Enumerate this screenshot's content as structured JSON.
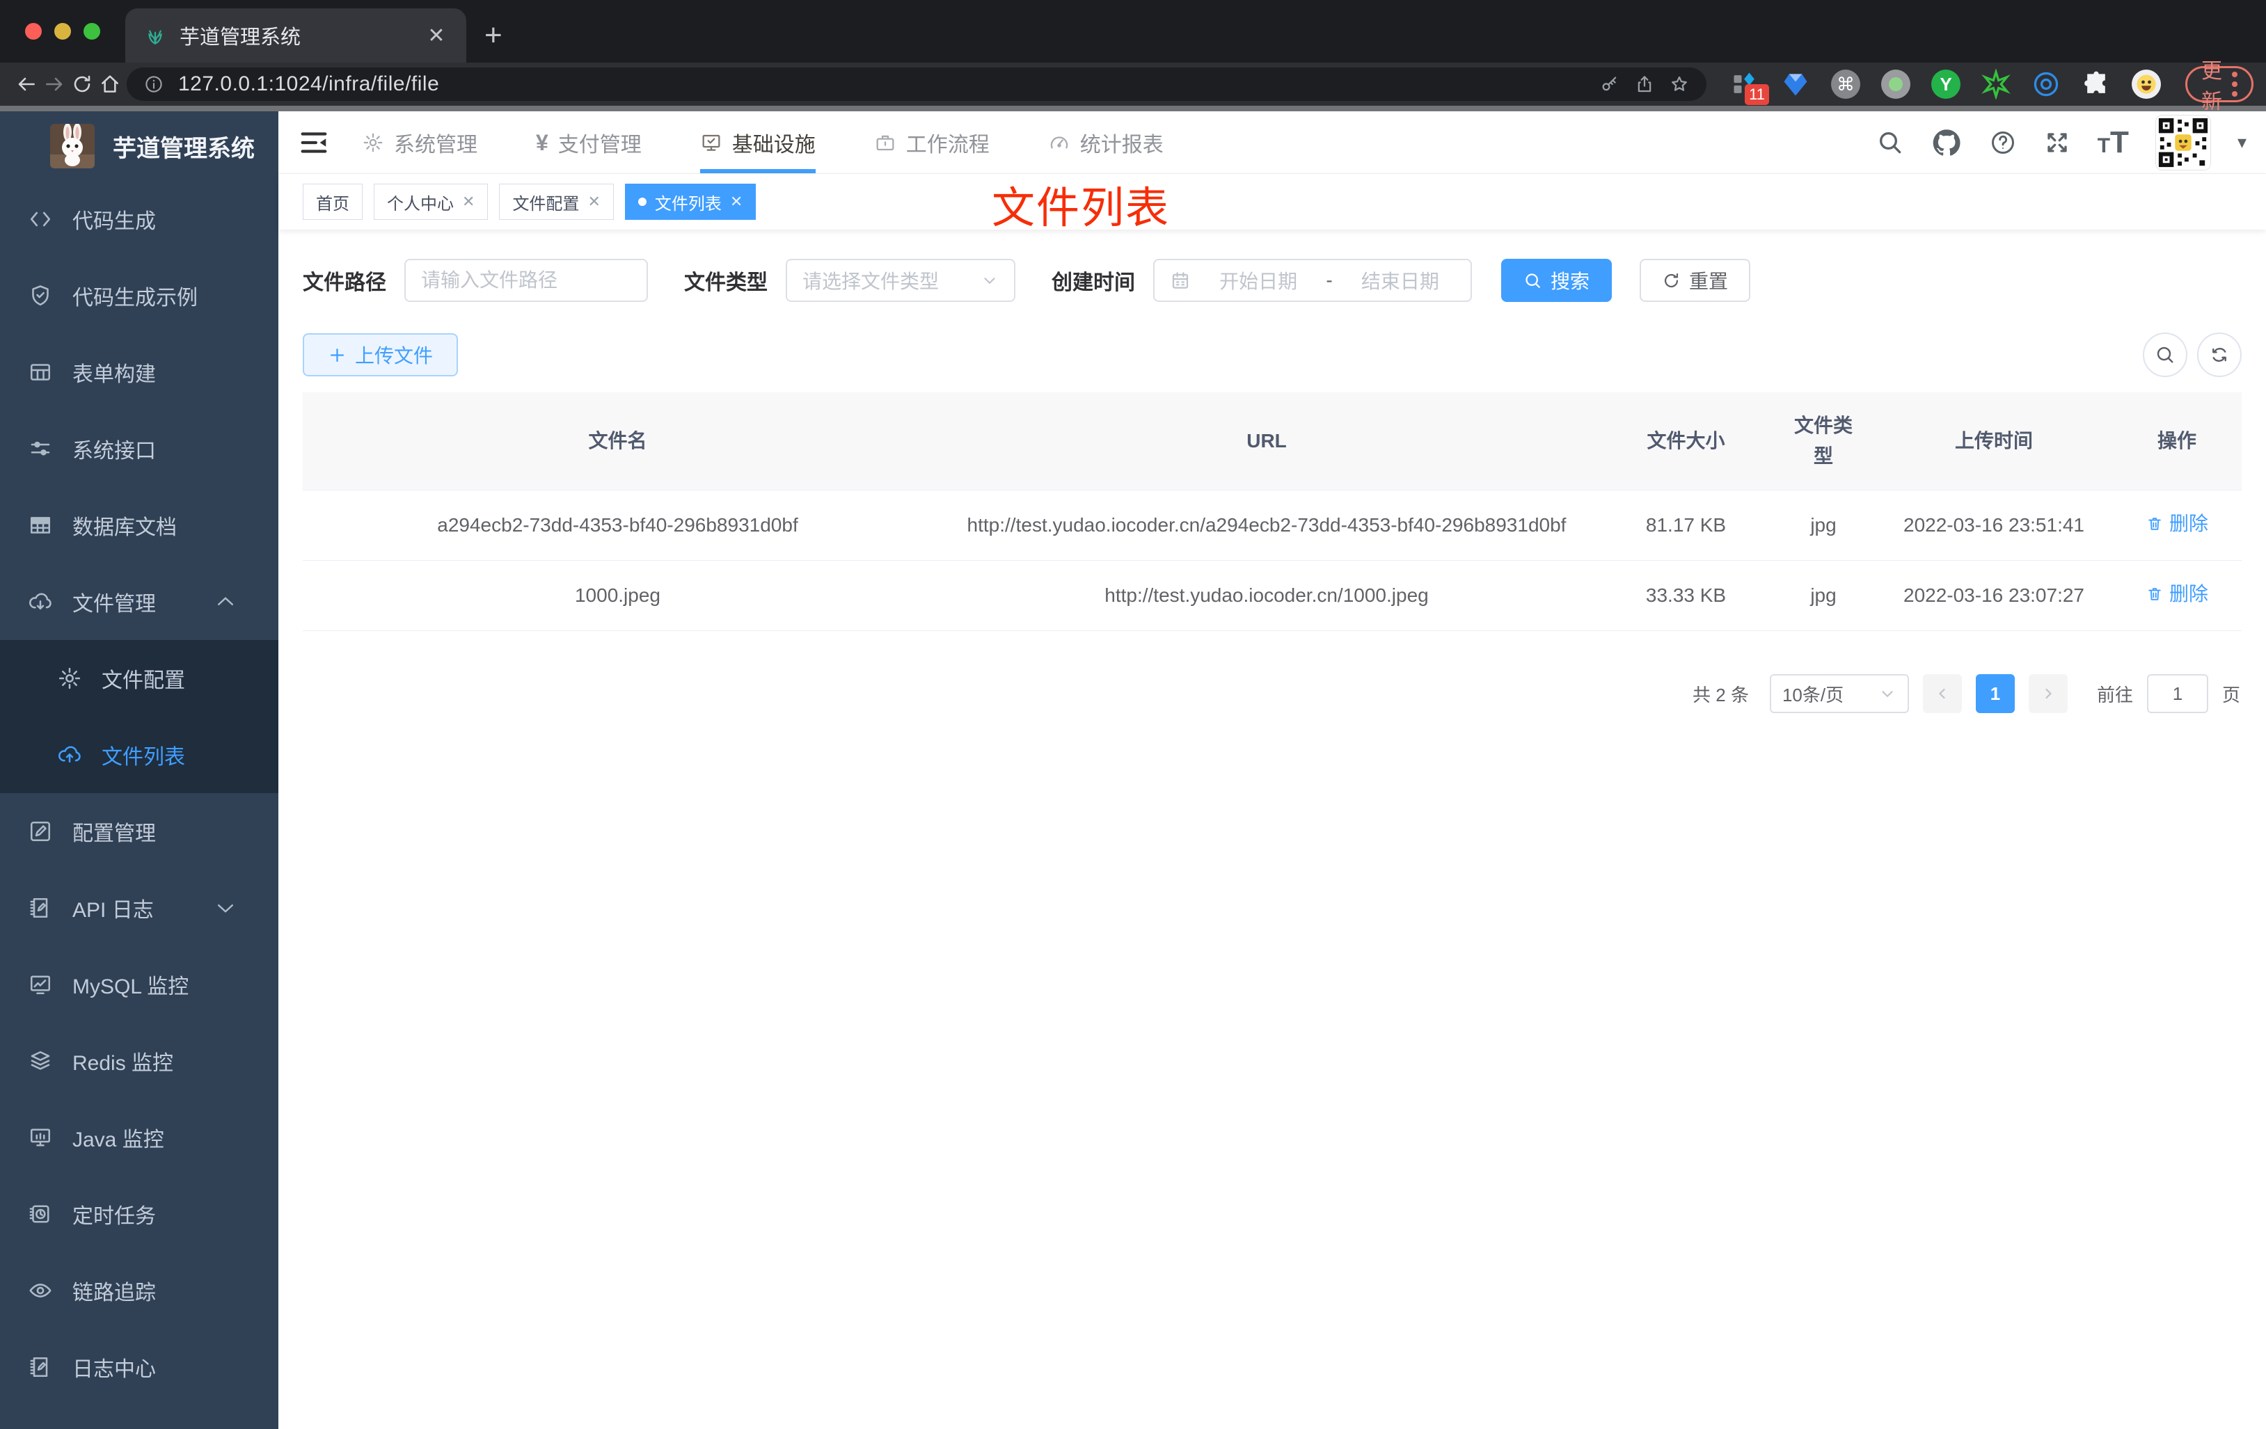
{
  "browser": {
    "tab_title": "芋道管理系统",
    "url": "127.0.0.1:1024/infra/file/file",
    "update_label": "更新",
    "extension_badge": "11",
    "traffic_colors": [
      "#fb5f57",
      "#d9b53f",
      "#3cc23e"
    ]
  },
  "app": {
    "logo_title": "芋道管理系统",
    "accent_color": "#409eff"
  },
  "sidebar": {
    "items": [
      {
        "label": "代码生成",
        "icon": "code"
      },
      {
        "label": "代码生成示例",
        "icon": "shield"
      },
      {
        "label": "表单构建",
        "icon": "formtable"
      },
      {
        "label": "系统接口",
        "icon": "sliders"
      },
      {
        "label": "数据库文档",
        "icon": "dbgrid"
      },
      {
        "label": "文件管理",
        "icon": "cloud-down",
        "arrow": "up"
      },
      {
        "label": "文件配置",
        "icon": "gear",
        "sub": true
      },
      {
        "label": "文件列表",
        "icon": "cloud-up",
        "sub": true,
        "active": true
      },
      {
        "label": "配置管理",
        "icon": "edit"
      },
      {
        "label": "API 日志",
        "icon": "log",
        "arrow": "down"
      },
      {
        "label": "MySQL 监控",
        "icon": "chart"
      },
      {
        "label": "Redis 监控",
        "icon": "layers"
      },
      {
        "label": "Java 监控",
        "icon": "monitor"
      },
      {
        "label": "定时任务",
        "icon": "timer"
      },
      {
        "label": "链路追踪",
        "icon": "eye"
      },
      {
        "label": "日志中心",
        "icon": "log"
      }
    ]
  },
  "topnav": {
    "items": [
      {
        "label": "系统管理",
        "icon": "gear"
      },
      {
        "label": "支付管理",
        "icon": "yen"
      },
      {
        "label": "基础设施",
        "icon": "monitor-check",
        "active": true
      },
      {
        "label": "工作流程",
        "icon": "briefcase"
      },
      {
        "label": "统计报表",
        "icon": "gauge"
      }
    ]
  },
  "tags": [
    {
      "label": "首页"
    },
    {
      "label": "个人中心",
      "closable": true
    },
    {
      "label": "文件配置",
      "closable": true
    },
    {
      "label": "文件列表",
      "closable": true,
      "active": true
    }
  ],
  "annotation": {
    "text": "文件列表",
    "color": "#f62e08"
  },
  "filter": {
    "path_label": "文件路径",
    "path_placeholder": "请输入文件路径",
    "type_label": "文件类型",
    "type_placeholder": "请选择文件类型",
    "date_label": "创建时间",
    "date_start_placeholder": "开始日期",
    "date_separator": "-",
    "date_end_placeholder": "结束日期",
    "search_label": "搜索",
    "reset_label": "重置",
    "upload_label": "上传文件"
  },
  "table": {
    "headers": [
      "文件名",
      "URL",
      "文件大小",
      "文件类型",
      "上传时间",
      "操作"
    ],
    "rows": [
      {
        "name": "a294ecb2-73dd-4353-bf40-296b8931d0bf",
        "url": "http://test.yudao.iocoder.cn/a294ecb2-73dd-4353-bf40-296b8931d0bf",
        "size": "81.17 KB",
        "type": "jpg",
        "time": "2022-03-16 23:51:41",
        "action": "删除"
      },
      {
        "name": "1000.jpeg",
        "url": "http://test.yudao.iocoder.cn/1000.jpeg",
        "size": "33.33 KB",
        "type": "jpg",
        "time": "2022-03-16 23:07:27",
        "action": "删除"
      }
    ]
  },
  "pagination": {
    "total": "共 2 条",
    "page_size": "10条/页",
    "current_page": "1",
    "goto_label": "前往",
    "goto_value": "1",
    "goto_suffix": "页"
  }
}
